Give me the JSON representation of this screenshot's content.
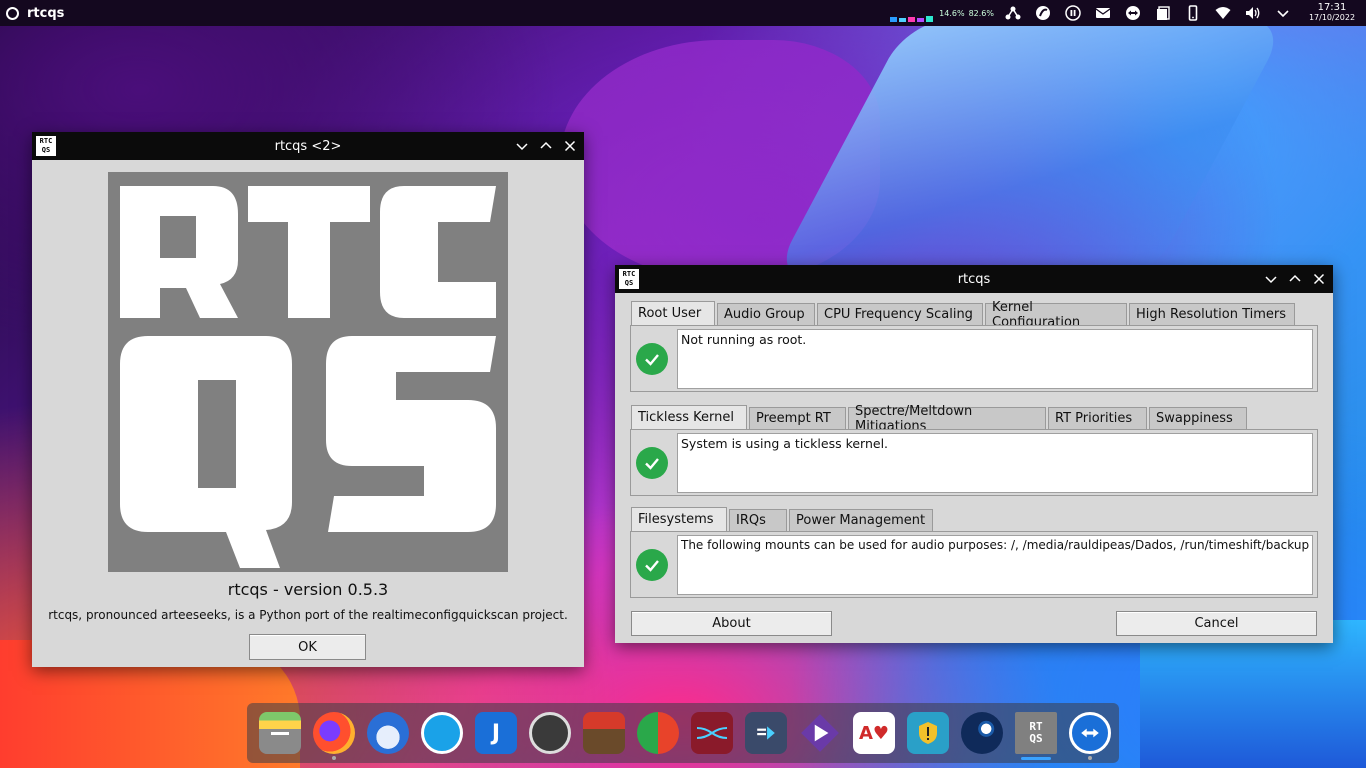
{
  "top_panel": {
    "app_title": "rtcqs",
    "cpu_percent": "14.6%",
    "mem_percent": "82.6%",
    "time": "17:31",
    "date": "17/10/2022",
    "tray_icons": [
      "network-graph-icon",
      "ghost-icon",
      "pause-icon",
      "mail-icon",
      "teamviewer-icon",
      "clipboard-icon",
      "phone-icon",
      "wifi-icon",
      "volume-icon",
      "chevron-down-icon"
    ]
  },
  "about_window": {
    "title": "rtcqs <2>",
    "logo_text_line1": "RTC",
    "logo_text_line2": "QS",
    "version": "rtcqs - version 0.5.3",
    "description": "rtcqs, pronounced arteeseeks, is a Python port of the realtimeconfigquickscan project.",
    "ok_label": "OK"
  },
  "main_window": {
    "title": "rtcqs",
    "groups": [
      {
        "tabs": [
          "Root User",
          "Audio Group",
          "CPU Frequency Scaling",
          "Kernel Configuration",
          "High Resolution Timers"
        ],
        "active_tab": "Root User",
        "message": "Not running as root."
      },
      {
        "tabs": [
          "Tickless Kernel",
          "Preempt RT",
          "Spectre/Meltdown Mitigations",
          "RT Priorities",
          "Swappiness"
        ],
        "active_tab": "Tickless Kernel",
        "message": "System is using a tickless kernel."
      },
      {
        "tabs": [
          "Filesystems",
          "IRQs",
          "Power Management"
        ],
        "active_tab": "Filesystems",
        "message": "The following mounts can be used for audio purposes: /, /media/rauldipeas/Dados, /run/timeshift/backup"
      }
    ],
    "about_label": "About",
    "cancel_label": "Cancel"
  },
  "dock": {
    "apps": [
      "file-manager-icon",
      "firefox-icon",
      "thunderbird-icon",
      "network-share-icon",
      "joplin-icon",
      "obs-icon",
      "game-emulator-icon",
      "anydesk-icon",
      "audio-editor-icon",
      "kdenlive-icon",
      "video-editor-icon",
      "solitaire-icon",
      "warning-app-icon",
      "steam-icon",
      "rtcqs-icon",
      "teamviewer-icon"
    ]
  },
  "colors": {
    "check_green": "#2aa84a",
    "titlebar": "#0b0b0b",
    "window_bg": "#d8d8d8"
  }
}
